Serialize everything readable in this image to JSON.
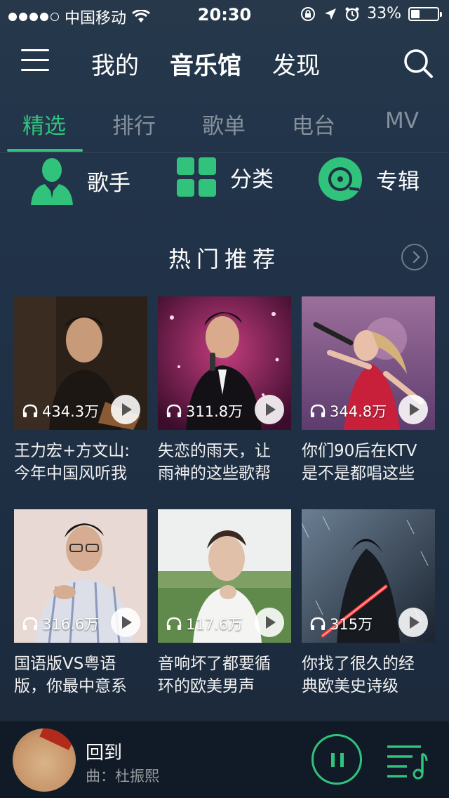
{
  "status_bar": {
    "carrier": "中国移动",
    "time": "20:30",
    "battery": "33%",
    "battery_level": 0.33
  },
  "top_nav": {
    "tabs": [
      {
        "label": "我的",
        "active": false
      },
      {
        "label": "音乐馆",
        "active": true
      },
      {
        "label": "发现",
        "active": false
      }
    ],
    "menu_icon": "hamburger-icon",
    "search_icon": "search-icon"
  },
  "sub_tabs": [
    {
      "label": "精选",
      "active": true
    },
    {
      "label": "排行",
      "active": false
    },
    {
      "label": "歌单",
      "active": false
    },
    {
      "label": "电台",
      "active": false
    },
    {
      "label": "MV",
      "active": false
    }
  ],
  "categories": [
    {
      "label": "歌手",
      "icon": "singer-icon"
    },
    {
      "label": "分类",
      "icon": "grid-icon"
    },
    {
      "label": "专辑",
      "icon": "vinyl-icon"
    }
  ],
  "section": {
    "title": "热门推荐"
  },
  "playlists": [
    {
      "count": "434.3万",
      "line1": "王力宏+方文山:",
      "line2": "今年中国风听我"
    },
    {
      "count": "311.8万",
      "line1": "失恋的雨天，让",
      "line2": "雨神的这些歌帮"
    },
    {
      "count": "344.8万",
      "line1": "你们90后在KTV",
      "line2": "是不是都唱这些"
    },
    {
      "count": "316.6万",
      "line1": "国语版VS粤语",
      "line2": "版，你最中意系"
    },
    {
      "count": "117.6万",
      "line1": "音响坏了都要循",
      "line2": "环的欧美男声"
    },
    {
      "count": "315万",
      "line1": "你找了很久的经",
      "line2": "典欧美史诗级"
    }
  ],
  "player": {
    "song": "回到",
    "artist": "曲：杜振熙"
  },
  "colors": {
    "accent": "#31c27c",
    "background": "#22344a"
  }
}
